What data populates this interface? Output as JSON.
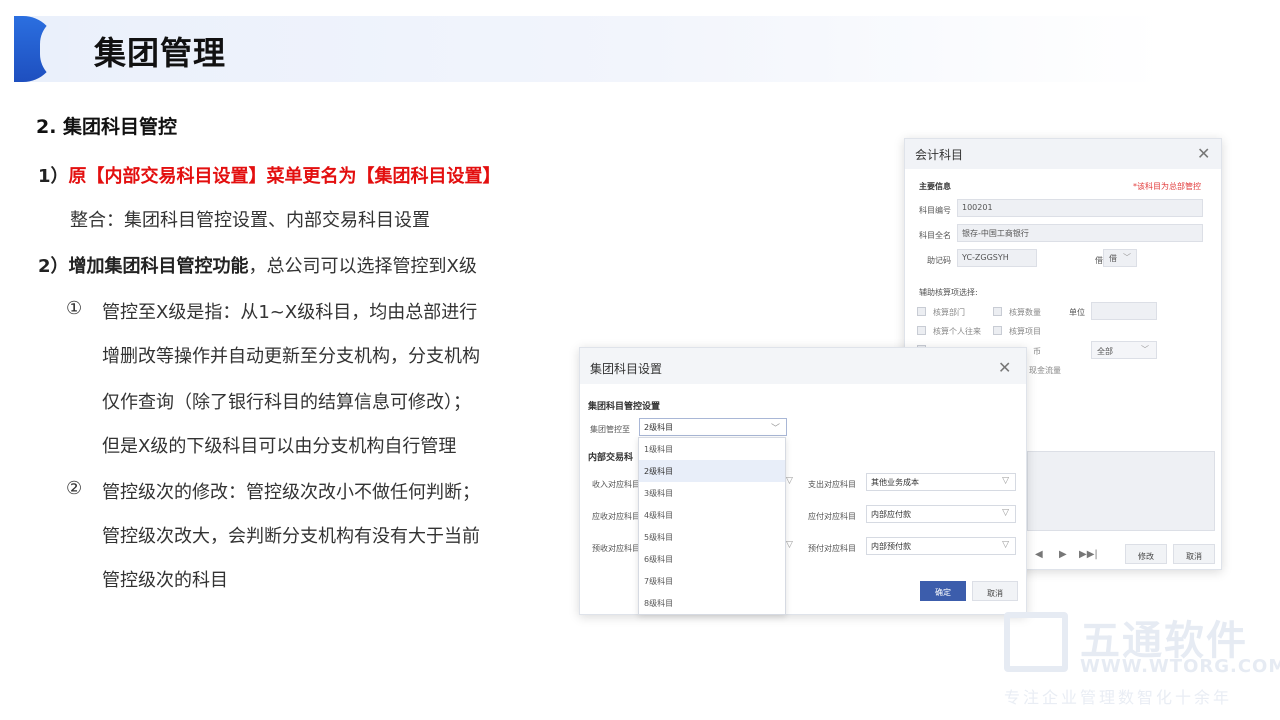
{
  "header": {
    "title": "集团管理"
  },
  "section": {
    "title": "2.   集团科目管控"
  },
  "points": {
    "p1_num": "1）",
    "p1_text": "原【内部交易科目设置】菜单更名为【集团科目设置】",
    "p1_sub": "整合：集团科目管控设置、内部交易科目设置",
    "p2_num": "2）",
    "p2_bold": "增加集团科目管控功能",
    "p2_rest": "，总公司可以选择管控到X级",
    "c1_mark": "①",
    "c1_lines": [
      "管控至X级是指：从1~X级科目，均由总部进行",
      "增删改等操作并自动更新至分支机构，分支机构",
      "仅作查询（除了银行科目的结算信息可修改）；",
      "但是X级的下级科目可以由分支机构自行管理"
    ],
    "c2_mark": "②",
    "c2_lines": [
      "管控级次的修改：管控级次改小不做任何判断；",
      "管控级次改大，会判断分支机构有没有大于当前",
      "管控级次的科目"
    ]
  },
  "back_dialog": {
    "title": "会计科目",
    "main_info": "主要信息",
    "note": "*该科目为总部管控",
    "code_label": "科目编号",
    "code_value": "100201",
    "name_label": "科目全名",
    "name_value": "银存-中国工商银行",
    "memo_label": "助记码",
    "memo_value": "YC-ZGGSYH",
    "dir_label": "借贷方向",
    "dir_value": "借",
    "aux_label": "辅助核算项选择:",
    "chk_dept": "核算部门",
    "chk_qty": "核算数量",
    "unit_label": "单位",
    "chk_person": "核算个人往来",
    "chk_project": "核算项目",
    "chk_currency": "币",
    "currency_value": "全部",
    "chk_cashflow": "现金流量",
    "modify": "修改",
    "cancel": "取消"
  },
  "front_dialog": {
    "title": "集团科目设置",
    "section1": "集团科目管控设置",
    "ctrl_label": "集团管控至",
    "ctrl_value": "2级科目",
    "section2": "内部交易科",
    "income_label": "收入对应科目",
    "expense_label": "支出对应科目",
    "expense_value": "其他业务成本",
    "recv_label": "应收对应科目",
    "pay_label": "应付对应科目",
    "pay_value": "内部应付款",
    "prerecv_label": "预收对应科目",
    "prepay_label": "预付对应科目",
    "prepay_value": "内部预付款",
    "ok": "确定",
    "cancel": "取消",
    "options": [
      "1级科目",
      "2级科目",
      "3级科目",
      "4级科目",
      "5级科目",
      "6级科目",
      "7级科目",
      "8级科目"
    ]
  },
  "watermark": {
    "brand": "五通软件",
    "url": "WWW.WTORG.COM",
    "tagline": "专注企业管理数智化十余年"
  }
}
